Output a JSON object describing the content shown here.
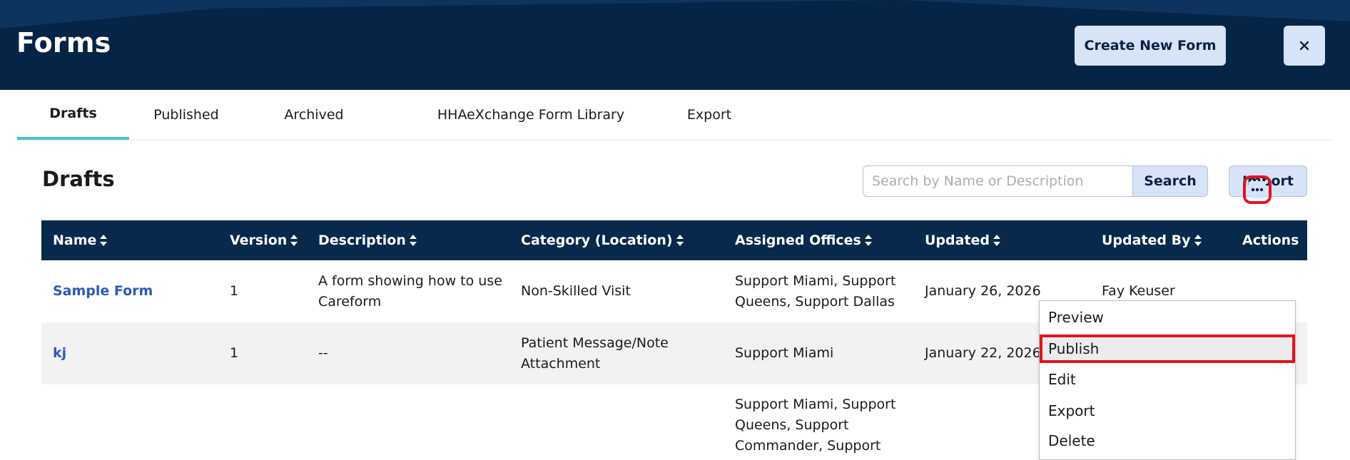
{
  "header": {
    "title": "Forms",
    "create_label": "Create New Form",
    "close_glyph": "×"
  },
  "tabs": [
    {
      "label": "Drafts",
      "active": true
    },
    {
      "label": "Published",
      "active": false
    },
    {
      "label": "Archived",
      "active": false
    },
    {
      "label": "HHAeXchange Form Library",
      "active": false
    },
    {
      "label": "Export",
      "active": false
    }
  ],
  "section": {
    "title": "Drafts",
    "search_placeholder": "Search by Name or Description",
    "search_label": "Search",
    "import_label": "Import"
  },
  "table": {
    "columns": [
      "Name",
      "Version",
      "Description",
      "Category (Location)",
      "Assigned Offices",
      "Updated",
      "Updated By",
      "Actions"
    ],
    "rows": [
      {
        "name": "Sample Form",
        "version": "1",
        "description": "A form showing how to use Careform",
        "category": "Non-Skilled Visit",
        "offices": "Support Miami, Support Queens, Support Dallas",
        "updated": "January 26, 2026",
        "updated_by": "Fay Keuser"
      },
      {
        "name": "kj",
        "version": "1",
        "description": "--",
        "category": "Patient Message/Note Attachment",
        "offices": "Support Miami",
        "updated": "January 22, 2026",
        "updated_by": ""
      },
      {
        "name": "",
        "version": "",
        "description": "",
        "category": "",
        "offices": "Support Miami, Support Queens, Support Commander, Support",
        "updated": "",
        "updated_by": ""
      }
    ]
  },
  "actions_menu": {
    "items": [
      "Preview",
      "Publish",
      "Edit",
      "Export",
      "Delete"
    ],
    "highlighted": "Publish"
  },
  "colors": {
    "header_bg": "#08284c",
    "button_bg": "#d7e3f7",
    "tab_active": "#4ec3c1",
    "link": "#2a5bb5",
    "highlight": "#e4131c"
  },
  "icons": {
    "sort": "sort-icon",
    "close": "close-icon",
    "more": "more-horizontal-icon"
  }
}
